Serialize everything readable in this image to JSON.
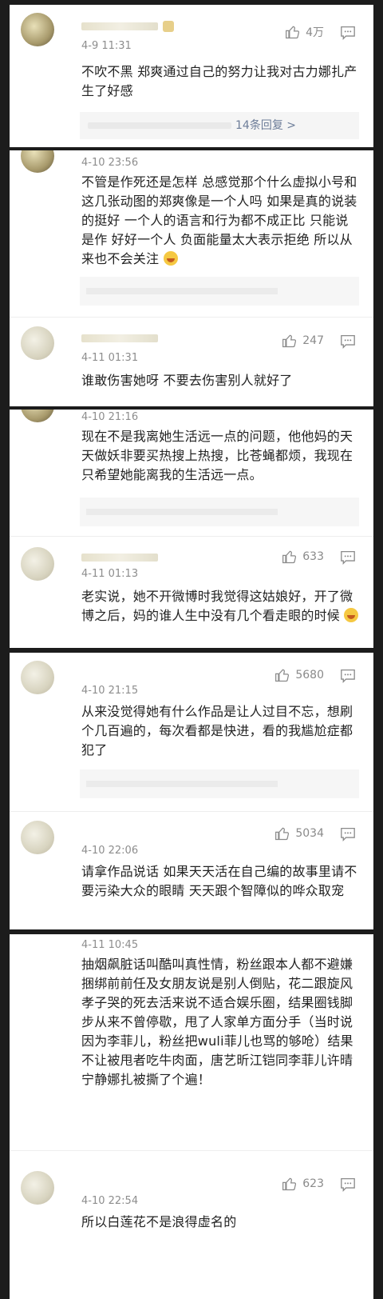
{
  "comments": [
    {
      "time": "4-9 11:31",
      "likes": "4万",
      "text": "不吹不黑 郑爽通过自己的努力让我对古力娜扎产生了好感",
      "reply_label": "14条回复 >"
    },
    {
      "time": "4-10 23:56",
      "text": "不管是作死还是怎样 总感觉那个什么虚拟小号和这几张动图的郑爽像是一个人吗 如果是真的说装的挺好 一个人的语言和行为都不成正比 只能说是作  好好一个人 负面能量太大表示拒绝 所以从来也不会关注"
    },
    {
      "time": "4-11 01:31",
      "likes": "247",
      "text": "谁敢伤害她呀 不要去伤害别人就好了"
    },
    {
      "time": "4-10 21:16",
      "text": "现在不是我离她生活远一点的问题，他他妈的天天做妖非要买热搜上热搜，比苍蝇都烦，我现在只希望她能离我的生活远一点。"
    },
    {
      "time": "4-11 01:13",
      "likes": "633",
      "text": "老实说，她不开微博时我觉得这姑娘好，开了微博之后，妈的谁人生中没有几个看走眼的时候"
    },
    {
      "time": "4-10 21:15",
      "likes": "5680",
      "text": "从来没觉得她有什么作品是让人过目不忘，想刷个几百遍的，每次看都是快进，看的我尴尬症都犯了"
    },
    {
      "time": "4-10 22:06",
      "likes": "5034",
      "text": "请拿作品说话 如果天天活在自己编的故事里请不要污染大众的眼睛 天天跟个智障似的哗众取宠"
    },
    {
      "time": "4-11 10:45",
      "text": "抽烟飙脏话叫酷叫真性情，粉丝跟本人都不避嫌捆绑前前任及女朋友说是别人倒贴，花二跟旋风孝子哭的死去活来说不适合娱乐圈，结果圈钱脚步从来不曾停歇，甩了人家单方面分手（当时说因为李菲儿，粉丝把wuli菲儿也骂的够呛）结果不让被甩者吃牛肉面，唐艺昕江铠同李菲儿许晴宁静娜扎被撕了个遍！"
    },
    {
      "time": "4-10 22:54",
      "likes": "623",
      "text": "所以白莲花不是浪得虚名的"
    }
  ],
  "icons": {
    "like": "thumbs-up-icon",
    "comment": "comment-bubble-icon",
    "emoji": "grinning-emoji-icon"
  },
  "colors": {
    "background": "#1c1c1c",
    "card": "#ffffff",
    "text": "#222222",
    "meta": "#8d8d8d",
    "link": "#6d7d99"
  }
}
